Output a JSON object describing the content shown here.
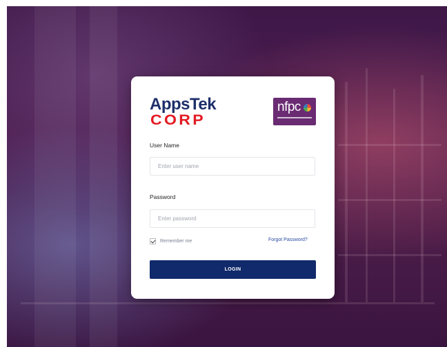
{
  "brand": {
    "logo_left": {
      "top_text": "AppsTek",
      "bottom_text": "CORP"
    },
    "logo_right": {
      "text": "nfpc"
    }
  },
  "form": {
    "username_label": "User Name",
    "username_placeholder": "Enter user name",
    "password_label": "Password",
    "password_placeholder": "Enter password",
    "remember_label": "Remember me",
    "remember_checked": true,
    "forgot_label": "Forgot Password?",
    "login_label": "LOGIN"
  },
  "colors": {
    "primary_button": "#102a6b",
    "brand_blue": "#1e2f6b",
    "brand_red": "#e31b23",
    "nfpc_purple": "#6a2b73",
    "link": "#2a4aa3"
  }
}
